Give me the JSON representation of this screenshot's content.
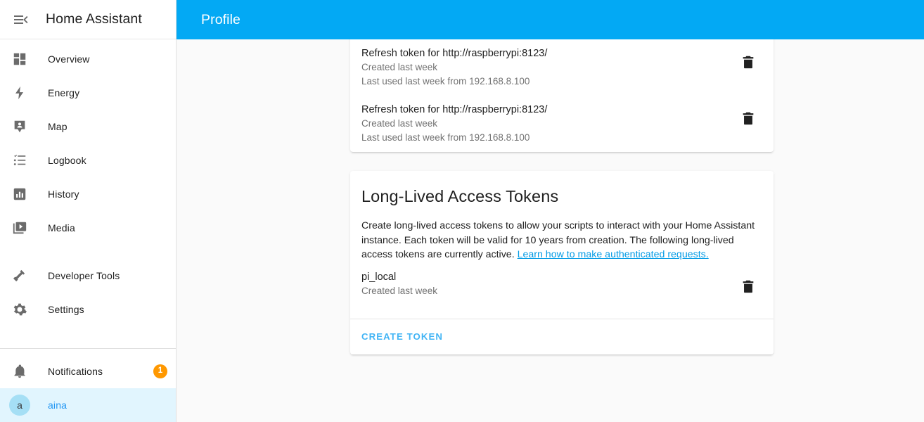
{
  "sidebar": {
    "menu_icon": "menu-collapse-icon",
    "title": "Home Assistant",
    "items": [
      {
        "label": "Overview",
        "icon": "view-dashboard-icon"
      },
      {
        "label": "Energy",
        "icon": "lightning-bolt-icon"
      },
      {
        "label": "Map",
        "icon": "map-marker-account-icon"
      },
      {
        "label": "Logbook",
        "icon": "format-list-bulleted-icon"
      },
      {
        "label": "History",
        "icon": "chart-box-icon"
      },
      {
        "label": "Media",
        "icon": "play-box-multiple-icon"
      }
    ],
    "tools": [
      {
        "label": "Developer Tools",
        "icon": "hammer-icon"
      },
      {
        "label": "Settings",
        "icon": "cog-icon"
      }
    ],
    "notifications": {
      "label": "Notifications",
      "icon": "bell-icon",
      "badge": "1"
    },
    "user": {
      "label": "aina",
      "avatar_initial": "a"
    }
  },
  "toolbar": {
    "title": "Profile"
  },
  "refresh_tokens": {
    "rows": [
      {
        "title": "Refresh token for http://raspberrypi:8123/",
        "created": "Created last week",
        "last_used": "Last used last week from 192.168.8.100",
        "delete_icon": "trash-icon"
      },
      {
        "title": "Refresh token for http://raspberrypi:8123/",
        "created": "Created last week",
        "last_used": "Last used last week from 192.168.8.100",
        "delete_icon": "trash-icon"
      }
    ]
  },
  "long_lived": {
    "heading": "Long-Lived Access Tokens",
    "description_part1": "Create long-lived access tokens to allow your scripts to interact with your Home Assistant instance. Each token will be valid for 10 years from creation. The following long-lived access tokens are currently active. ",
    "link_text": "Learn how to make authenticated requests.",
    "token": {
      "name": "pi_local",
      "created": "Created last week",
      "delete_icon": "trash-icon"
    },
    "create_button": "Create Token"
  },
  "colors": {
    "accent_blue": "#03a9f4",
    "link_blue": "#039be5",
    "badge_orange": "#ff9800",
    "selected_bg": "#e1f5fe",
    "avatar_bg": "#a5dff5",
    "content_bg": "#fafafa"
  }
}
